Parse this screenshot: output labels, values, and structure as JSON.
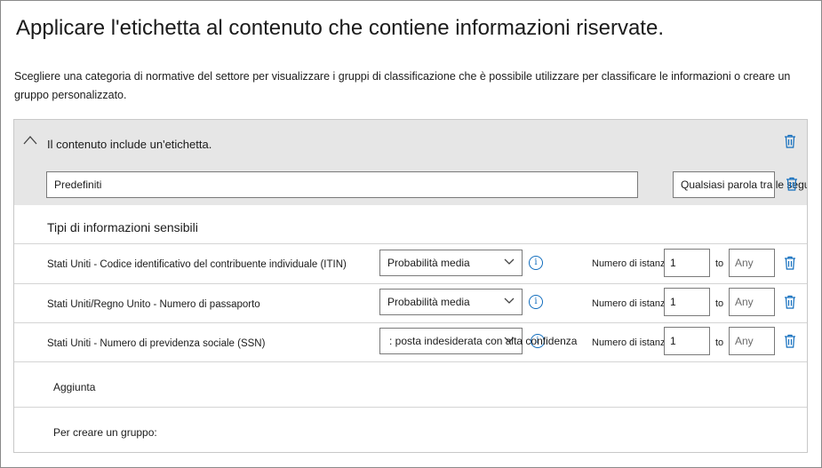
{
  "page": {
    "title": "Applicare l'etichetta al contenuto che contiene informazioni riservate.",
    "description": "Scegliere una categoria di normative del settore per visualizzare i gruppi di classificazione che è possibile utilizzare per classificare le informazioni o creare un gruppo personalizzato."
  },
  "condition": {
    "label": "Il contenuto include un'etichetta.",
    "group_name": "Predefiniti",
    "match_button": "Qualsiasi parola tra le seguenti",
    "section_title": "Tipi di informazioni sensibili"
  },
  "rows": [
    {
      "name": "Stati Uniti - Codice identificativo del contribuente individuale (ITIN)",
      "confidence": "Probabilità media",
      "instances_label": "Numero di istanze",
      "min": "1",
      "to": "to",
      "max_placeholder": "Any"
    },
    {
      "name": "Stati Uniti/Regno Unito - Numero di passaporto",
      "confidence": "Probabilità media",
      "instances_label": "Numero di istanze",
      "min": "1",
      "to": "to",
      "max_placeholder": "Any"
    },
    {
      "name": "Stati Uniti - Numero di previdenza sociale (SSN)",
      "confidence": ": posta indesiderata con alta confidenza",
      "instances_label": "Numero di istanze",
      "min": "1",
      "to": "to",
      "max_placeholder": "Any"
    }
  ],
  "actions": {
    "add": "Aggiunta",
    "create_group": "Per creare un gruppo:"
  },
  "icons": {
    "collapse": "chevron-up-icon",
    "delete": "trash-icon",
    "info": "info-icon",
    "dropdown": "chevron-down-icon"
  },
  "colors": {
    "accent": "#0f6cbd",
    "header_bg": "#e6e6e6"
  }
}
